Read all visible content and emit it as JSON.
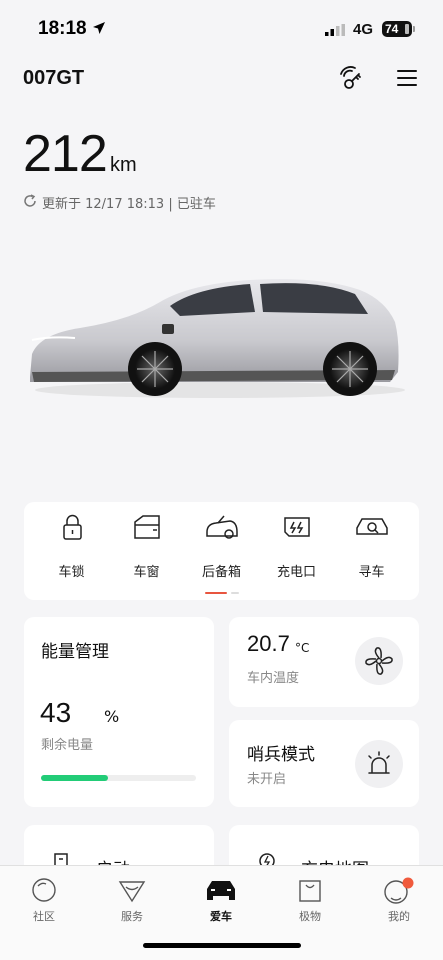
{
  "status": {
    "time": "18:18",
    "network": "4G",
    "battery": "74"
  },
  "header": {
    "title": "007GT"
  },
  "range": {
    "value": "212",
    "unit": "km",
    "updated": "更新于 12/17 18:13 | 已驻车"
  },
  "controls": [
    {
      "label": "车锁"
    },
    {
      "label": "车窗"
    },
    {
      "label": "后备箱"
    },
    {
      "label": "充电口"
    },
    {
      "label": "寻车"
    }
  ],
  "energy": {
    "title": "能量管理",
    "percent": "43",
    "unit": "%",
    "label": "剩余电量",
    "level": 0.43
  },
  "climate": {
    "temp": "20.7",
    "unit": "°C",
    "label": "车内温度"
  },
  "sentry": {
    "title": "哨兵模式",
    "status": "未开启"
  },
  "bottom_cards": {
    "left_title": "启动",
    "right_title": "充电地图"
  },
  "tabs": [
    {
      "label": "社区"
    },
    {
      "label": "服务"
    },
    {
      "label": "爱车"
    },
    {
      "label": "极物"
    },
    {
      "label": "我的"
    }
  ],
  "colors": {
    "accent": "#22cc77",
    "indicator": "#e8553f",
    "notification": "#f05a3c"
  }
}
